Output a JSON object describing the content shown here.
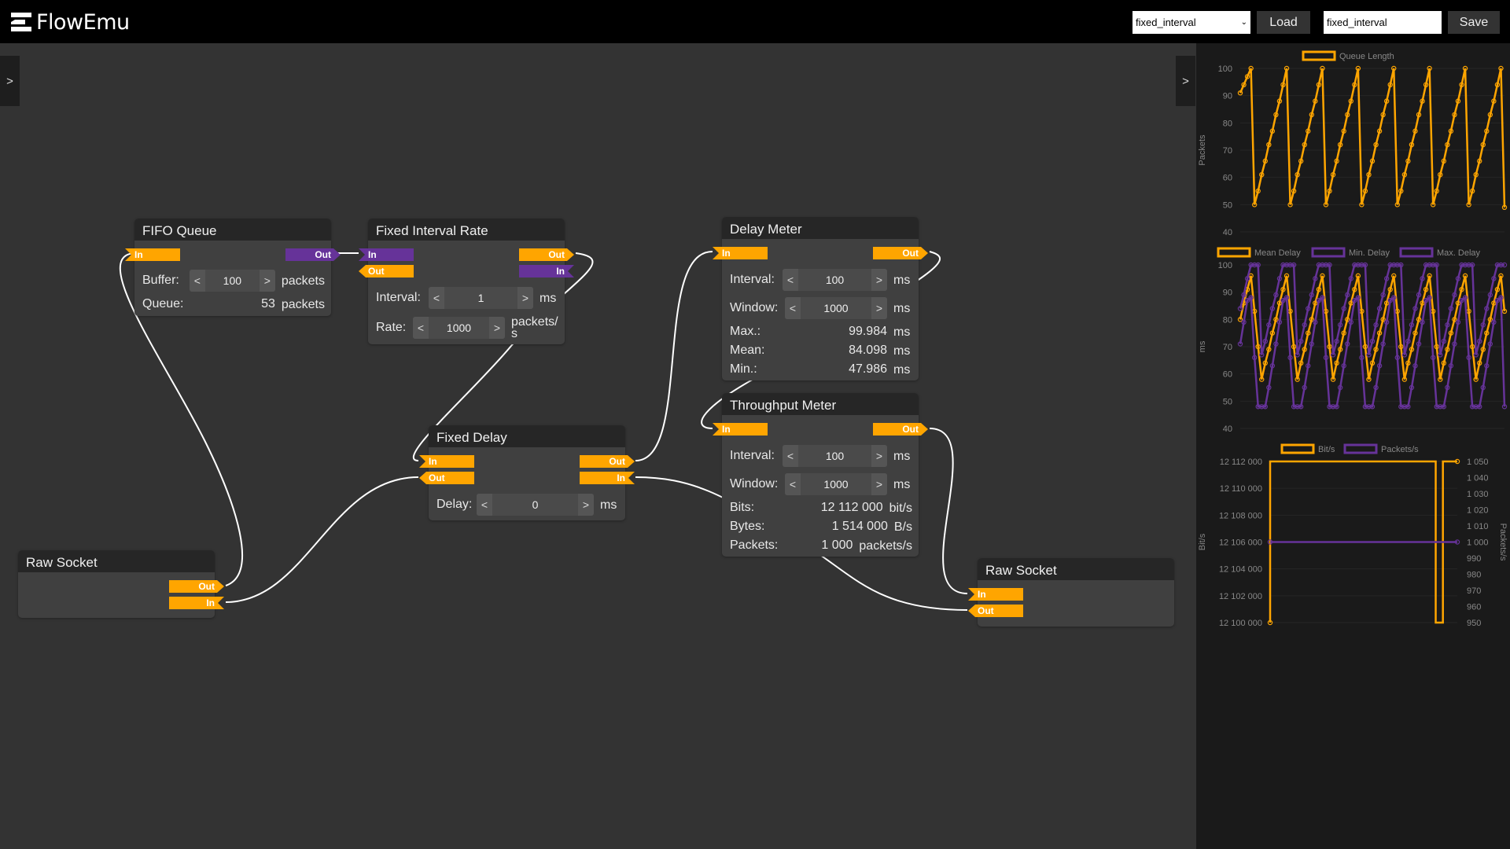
{
  "header": {
    "app_name": "FlowEmu",
    "load_select_value": "fixed_interval",
    "load_label": "Load",
    "save_input_value": "fixed_interval",
    "save_label": "Save",
    "left_toggle": ">",
    "right_toggle": ">"
  },
  "colors": {
    "port_orange": "#ffa500",
    "port_purple": "#663399",
    "canvas": "#333333",
    "panel": "#1a1a1a"
  },
  "nodes": {
    "fifo": {
      "title": "FIFO Queue",
      "in": "In",
      "out": "Out",
      "buffer_label": "Buffer:",
      "buffer_value": "100",
      "buffer_unit": "packets",
      "queue_label": "Queue:",
      "queue_value": "53",
      "queue_unit": "packets"
    },
    "fir": {
      "title": "Fixed Interval Rate",
      "in_left": "In",
      "out_left": "Out",
      "out_right": "Out",
      "in_right": "In",
      "interval_label": "Interval:",
      "interval_value": "1",
      "interval_unit": "ms",
      "rate_label": "Rate:",
      "rate_value": "1000",
      "rate_unit": "packets/ s"
    },
    "delay_meter": {
      "title": "Delay Meter",
      "in": "In",
      "out": "Out",
      "interval_label": "Interval:",
      "interval_value": "100",
      "interval_unit": "ms",
      "window_label": "Window:",
      "window_value": "1000",
      "window_unit": "ms",
      "max_label": "Max.:",
      "max_value": "99.984",
      "max_unit": "ms",
      "mean_label": "Mean:",
      "mean_value": "84.098",
      "mean_unit": "ms",
      "min_label": "Min.:",
      "min_value": "47.986",
      "min_unit": "ms"
    },
    "throughput_meter": {
      "title": "Throughput Meter",
      "in": "In",
      "out": "Out",
      "interval_label": "Interval:",
      "interval_value": "100",
      "interval_unit": "ms",
      "window_label": "Window:",
      "window_value": "1000",
      "window_unit": "ms",
      "bits_label": "Bits:",
      "bits_value": "12 112 000",
      "bits_unit": "bit/s",
      "bytes_label": "Bytes:",
      "bytes_value": "1 514 000",
      "bytes_unit": "B/s",
      "packets_label": "Packets:",
      "packets_value": "1 000",
      "packets_unit": "packets/s"
    },
    "fixed_delay": {
      "title": "Fixed Delay",
      "in_left": "In",
      "out_left": "Out",
      "out_right": "Out",
      "in_right": "In",
      "delay_label": "Delay:",
      "delay_value": "0",
      "delay_unit": "ms"
    },
    "raw_socket_left": {
      "title": "Raw Socket",
      "out": "Out",
      "in": "In"
    },
    "raw_socket_right": {
      "title": "Raw Socket",
      "in": "In",
      "out": "Out"
    }
  },
  "stepper": {
    "dec": "<",
    "inc": ">"
  },
  "chart_data": [
    {
      "type": "line",
      "ylabel": "Packets",
      "ylim": [
        40,
        100
      ],
      "yticks": [
        "40",
        "50",
        "60",
        "70",
        "80",
        "90",
        "100"
      ],
      "grid": true,
      "legend": "top",
      "series": [
        {
          "name": "Queue Length",
          "color": "#ffa500",
          "values": [
            91,
            94,
            97,
            100,
            50,
            55,
            61,
            66,
            72,
            77,
            83,
            88,
            94,
            100,
            50,
            55,
            61,
            66,
            72,
            77,
            83,
            88,
            94,
            100,
            50,
            55,
            61,
            66,
            72,
            77,
            83,
            88,
            94,
            100,
            50,
            55,
            61,
            66,
            72,
            77,
            83,
            88,
            94,
            100,
            50,
            55,
            61,
            66,
            72,
            77,
            83,
            88,
            94,
            100,
            50,
            55,
            61,
            66,
            72,
            77,
            83,
            88,
            94,
            100,
            50,
            55,
            61,
            66,
            72,
            77,
            83,
            88,
            94,
            100,
            49
          ]
        }
      ]
    },
    {
      "type": "line",
      "ylabel": "ms",
      "ylim": [
        40,
        100
      ],
      "yticks": [
        "40",
        "50",
        "60",
        "70",
        "80",
        "90",
        "100"
      ],
      "grid": true,
      "legend": "top",
      "series": [
        {
          "name": "Mean Delay",
          "color": "#ffa500",
          "values": [
            80,
            86,
            91,
            96,
            83,
            70,
            58,
            64,
            69,
            75,
            80,
            86,
            91,
            96,
            83,
            70,
            58,
            64,
            69,
            75,
            80,
            86,
            91,
            96,
            83,
            70,
            58,
            64,
            69,
            75,
            80,
            86,
            91,
            96,
            83,
            70,
            58,
            64,
            69,
            75,
            80,
            86,
            91,
            96,
            83,
            70,
            58,
            64,
            69,
            75,
            80,
            86,
            91,
            96,
            83,
            70,
            58,
            64,
            69,
            75,
            80,
            86,
            91,
            96,
            83,
            70,
            58,
            64,
            69,
            75,
            80,
            86,
            91,
            96,
            83
          ]
        },
        {
          "name": "Min. Delay",
          "color": "#663399",
          "values": [
            71,
            79,
            87,
            88,
            66,
            48,
            48,
            48,
            55,
            63,
            71,
            79,
            87,
            88,
            66,
            48,
            48,
            48,
            55,
            63,
            71,
            79,
            87,
            88,
            66,
            48,
            48,
            48,
            55,
            63,
            71,
            79,
            87,
            88,
            66,
            48,
            48,
            48,
            55,
            63,
            71,
            79,
            87,
            88,
            66,
            48,
            48,
            48,
            55,
            63,
            71,
            79,
            87,
            88,
            66,
            48,
            48,
            48,
            55,
            63,
            71,
            79,
            87,
            88,
            66,
            48,
            48,
            48,
            55,
            63,
            71,
            79,
            87,
            88,
            48
          ]
        },
        {
          "name": "Max. Delay",
          "color": "#663399",
          "values": [
            84,
            89,
            95,
            100,
            100,
            100,
            67,
            72,
            78,
            84,
            89,
            95,
            100,
            100,
            100,
            100,
            67,
            72,
            78,
            84,
            89,
            95,
            100,
            100,
            100,
            100,
            67,
            72,
            78,
            84,
            89,
            95,
            100,
            100,
            100,
            100,
            67,
            72,
            78,
            84,
            89,
            95,
            100,
            100,
            100,
            100,
            67,
            72,
            78,
            84,
            89,
            95,
            100,
            100,
            100,
            100,
            67,
            72,
            78,
            84,
            89,
            95,
            100,
            100,
            100,
            100,
            67,
            72,
            78,
            84,
            89,
            95,
            100,
            100,
            100
          ]
        }
      ]
    },
    {
      "type": "line",
      "ylabel": "Bit/s",
      "y2label": "Packets/s",
      "ylim": [
        12100000,
        12112000
      ],
      "y2lim": [
        950,
        1050
      ],
      "grid": true,
      "legend": "top",
      "yticks": [
        "12 100 000",
        "12 102 000",
        "12 104 000",
        "12 106 000",
        "12 108 000",
        "12 110 000",
        "12 112 000"
      ],
      "y2ticks": [
        "950",
        "960",
        "970",
        "980",
        "990",
        "1 000",
        "1 010",
        "1 020",
        "1 030",
        "1 040",
        "1 050"
      ],
      "series": [
        {
          "name": "Bit/s",
          "color": "#ffa500",
          "axis": "left",
          "values": [
            12100000,
            12112000,
            12112000,
            12112000,
            12112000,
            12112000,
            12112000,
            12112000,
            12112000,
            12112000,
            12112000,
            12112000,
            12112000,
            12112000,
            12112000,
            12112000,
            12112000,
            12112000,
            12112000,
            12112000,
            12112000,
            12112000,
            12112000,
            12112000,
            12100000,
            12112000,
            12112000
          ]
        },
        {
          "name": "Packets/s",
          "color": "#663399",
          "axis": "right",
          "values": [
            1000,
            1000,
            1000,
            1000,
            1000,
            1000,
            1000,
            1000,
            1000,
            1000,
            1000,
            1000,
            1000,
            1000,
            1000,
            1000,
            1000,
            1000,
            1000,
            1000,
            1000,
            1000,
            1000,
            1000,
            1000,
            1000,
            1000
          ]
        }
      ]
    }
  ]
}
